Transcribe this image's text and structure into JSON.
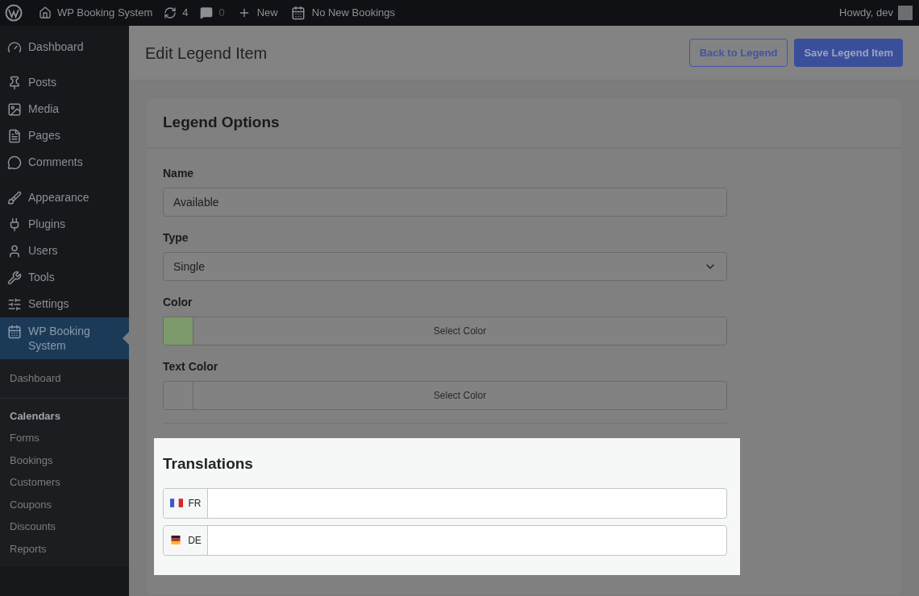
{
  "admin_bar": {
    "site": "WP Booking System",
    "updates": "4",
    "comments": "0",
    "new": "New",
    "bookings": "No New Bookings",
    "greeting": "Howdy, dev"
  },
  "sidebar": {
    "items": [
      {
        "label": "Dashboard",
        "selected": false
      },
      {
        "label": "Posts",
        "selected": false
      },
      {
        "label": "Media",
        "selected": false
      },
      {
        "label": "Pages",
        "selected": false
      },
      {
        "label": "Comments",
        "selected": false
      },
      {
        "label": "Appearance",
        "selected": false
      },
      {
        "label": "Plugins",
        "selected": false
      },
      {
        "label": "Users",
        "selected": false
      },
      {
        "label": "Tools",
        "selected": false
      },
      {
        "label": "Settings",
        "selected": false
      },
      {
        "label": "WP Booking System",
        "selected": true
      }
    ],
    "submenu": [
      {
        "label": "Dashboard",
        "selected": false
      },
      {
        "label": "Calendars",
        "selected": true
      },
      {
        "label": "Forms",
        "selected": false
      },
      {
        "label": "Bookings",
        "selected": false
      },
      {
        "label": "Customers",
        "selected": false
      },
      {
        "label": "Coupons",
        "selected": false
      },
      {
        "label": "Discounts",
        "selected": false
      },
      {
        "label": "Reports",
        "selected": false
      }
    ]
  },
  "page": {
    "title": "Edit Legend Item",
    "buttons": [
      {
        "label": "Back to Legend",
        "kind": "secondary"
      },
      {
        "label": "Save Legend Item",
        "kind": "primary"
      }
    ]
  },
  "card": {
    "title": "Legend Options",
    "fields": [
      {
        "label": "Name",
        "kind": "text",
        "value": "Available"
      },
      {
        "label": "Type",
        "kind": "select",
        "value": "Single"
      },
      {
        "label": "Color",
        "kind": "color",
        "button": "Select Color",
        "color": "#7c9a6c"
      },
      {
        "label": "Text Color",
        "kind": "color",
        "button": "Select Color"
      }
    ]
  },
  "translations": {
    "title": "Translations",
    "items": [
      {
        "code": "FR",
        "kind": "france"
      },
      {
        "code": "DE",
        "kind": "germany"
      }
    ]
  }
}
